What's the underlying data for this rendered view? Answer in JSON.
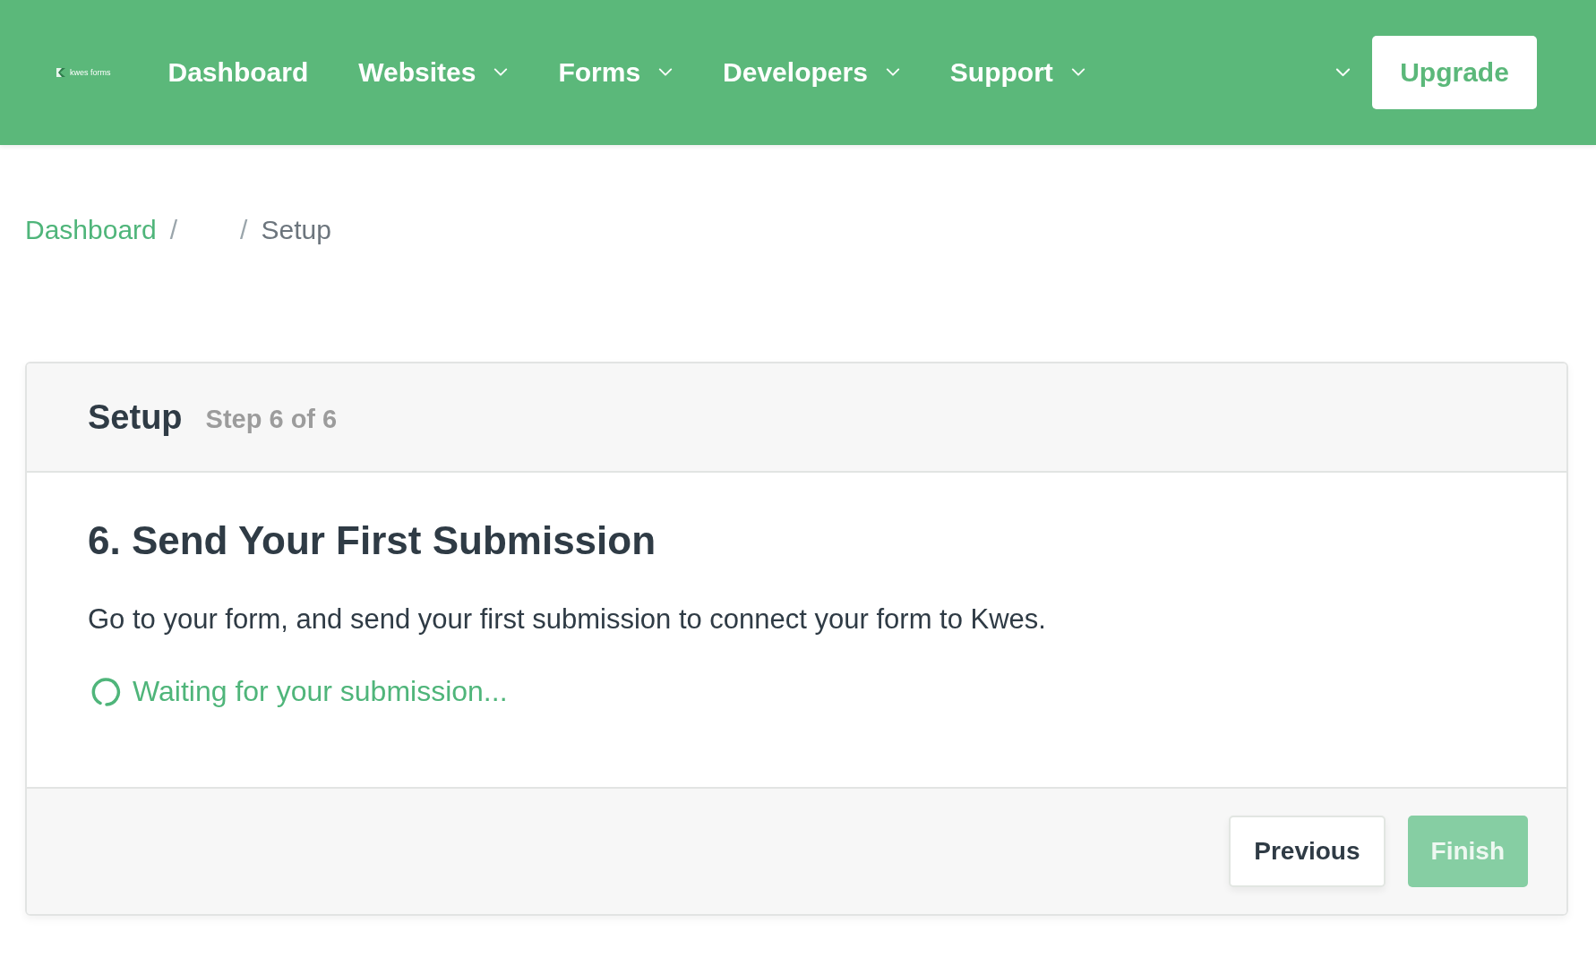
{
  "header": {
    "logo": {
      "text": "kwes forms"
    },
    "nav": [
      {
        "label": "Dashboard",
        "has_menu": false
      },
      {
        "label": "Websites",
        "has_menu": true
      },
      {
        "label": "Forms",
        "has_menu": true
      },
      {
        "label": "Developers",
        "has_menu": true
      },
      {
        "label": "Support",
        "has_menu": true
      }
    ],
    "upgrade_button": "Upgrade"
  },
  "breadcrumb": [
    {
      "kind": "link",
      "label": "Dashboard"
    },
    {
      "kind": "blank",
      "separator": "/"
    },
    {
      "kind": "current",
      "separator": "/",
      "label": "Setup"
    }
  ],
  "card": {
    "title": "Setup",
    "step": "Step 6 of 6",
    "heading": "6. Send Your First Submission",
    "description": "Go to your form, and send your first submission to connect your form to Kwes.",
    "status": {
      "kind": "waiting",
      "text": "Waiting for your submission..."
    },
    "buttons": [
      {
        "kind": "secondary",
        "label": "Previous",
        "disabled": false
      },
      {
        "kind": "primary",
        "label": "Finish",
        "disabled": true
      }
    ]
  }
}
